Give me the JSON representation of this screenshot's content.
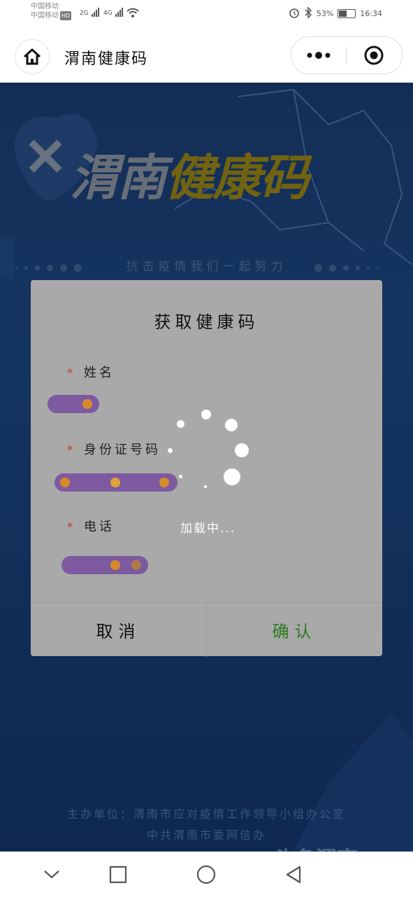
{
  "status_bar": {
    "carrier_1": "中国移动",
    "carrier_2": "中国移动",
    "hd_badge": "HD",
    "network_1": "2G",
    "network_2": "4G",
    "battery": "53%",
    "time": "16:34",
    "battery_level": 0.53
  },
  "header": {
    "title": "渭南健康码"
  },
  "background": {
    "brand_part1": "渭南",
    "brand_part2": "健康码",
    "slogan": "抗击疫情我们一起努力",
    "footer_line1": "主办单位：渭南市应对疫情工作领导小组办公室",
    "footer_line2": "中共渭南市委网信办",
    "watermark": "头条渭南"
  },
  "dialog": {
    "title": "获取健康码",
    "fields": [
      {
        "label": "姓名",
        "required_mark": "*"
      },
      {
        "label": "身份证号码",
        "required_mark": "*"
      },
      {
        "label": "电话",
        "required_mark": "*"
      }
    ],
    "cancel_label": "取消",
    "confirm_label": "确认"
  },
  "loading": {
    "text": "加载中..."
  },
  "colors": {
    "confirm_text": "#2d7a1f",
    "required_star": "#c0392b",
    "brand_gold": "#7a6a12",
    "background_blue": "#173968"
  },
  "icons": {
    "home": "home-icon",
    "more": "more-dots-icon",
    "close": "target-close-icon",
    "nav_back": "chevron-down-icon",
    "nav_recent": "square-icon",
    "nav_home": "circle-icon",
    "nav_triangle": "triangle-back-icon"
  }
}
